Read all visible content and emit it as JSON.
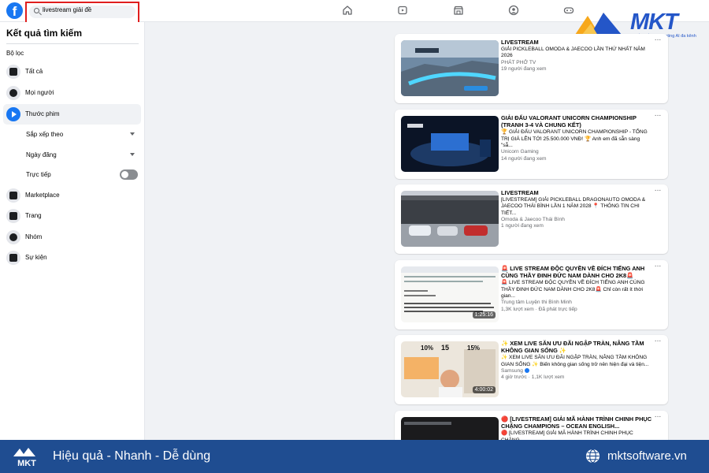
{
  "search": {
    "query": "livestream giải đề"
  },
  "brand": {
    "name": "MKT",
    "tagline": "Phần mềm Marketing AI đa kênh"
  },
  "sidebar": {
    "title": "Kết quả tìm kiếm",
    "filters_heading": "Bộ lọc",
    "items": [
      {
        "label": "Tất cả",
        "icon": "grid-icon"
      },
      {
        "label": "Mọi người",
        "icon": "people-icon"
      },
      {
        "label": "Thước phim",
        "icon": "video-play-icon",
        "active": true
      },
      {
        "label": "Marketplace",
        "icon": "shop-icon"
      },
      {
        "label": "Trang",
        "icon": "flag-icon"
      },
      {
        "label": "Nhóm",
        "icon": "group-icon"
      },
      {
        "label": "Sự kiện",
        "icon": "calendar-icon"
      }
    ],
    "video_filters": {
      "sort_label": "Sắp xếp theo",
      "date_label": "Ngày đăng",
      "live_label": "Trực tiếp",
      "live_on": false
    }
  },
  "results": [
    {
      "title": "LIVESTREAM",
      "desc": "GIẢI PICKLEBALL OMODA & JAECOO LẦN THỨ NHẤT NĂM 2026",
      "channel": "PHÁT PHỞ TV",
      "stats": "19 người đang xem",
      "duration": ""
    },
    {
      "title": "GIẢI ĐẤU VALORANT UNICORN CHAMPIONSHIP (TRANH 3-4 VÀ CHUNG KẾT)",
      "desc": "🏆 GIẢI ĐẤU VALORANT UNICORN CHAMPIONSHIP - TỔNG TRỊ GIÁ LÊN TỚI 25.500.000 VNĐ! 🏆 Anh em đã sẵn sàng \"sẵ...",
      "channel": "Unicorn Gaming",
      "stats": "14 người đang xem",
      "duration": ""
    },
    {
      "title": "LIVESTREAM",
      "desc": "[LIVESTREAM] GIẢI PICKLEBALL DRAGONAUTO OMODA & JAECOO THÁI BÌNH LẦN 1 NĂM 2028 📍 THÔNG TIN CHI TIẾT...",
      "channel": "Omoda & Jaecoo Thái Bình",
      "stats": "1 người đang xem",
      "duration": ""
    },
    {
      "title": "🚨 LIVE STREAM ĐỘC QUYỀN VỀ ĐÍCH TIẾNG ANH CÙNG THẦY ĐINH ĐỨC NAM DÀNH CHO 2K8🚨",
      "desc": "🚨 LIVE STREAM ĐỘC QUYỀN VỀ ĐÍCH TIẾNG ANH CÙNG THẦY ĐINH ĐỨC NAM DÀNH CHO 2K8🚨 Chỉ còn rất ít thời gian...",
      "channel": "Trung tâm Luyện thi Bình Minh",
      "stats": "1,3K lượt xem · Đã phát trực tiếp",
      "duration": "1:25:16"
    },
    {
      "title": "✨ XEM LIVE SĂN ƯU ĐÃI NGẬP TRÀN, NÂNG TẦM KHÔNG GIAN SỐNG ✨",
      "desc": "✨ XEM LIVE SĂN ƯU ĐÃI NGẬP TRÀN, NÂNG TẦM KHÔNG GIAN SỐNG ✨ Biến không gian sống trở nên hiện đại và tiện...",
      "channel": "Samsung",
      "stats": "4 giờ trước · 1,1K lượt xem",
      "duration": "4:00:02",
      "verified": true
    },
    {
      "title": "🔴 [LIVESTREAM] GIẢI MÃ HÀNH TRÌNH CHINH PHỤC CHẶNG CHAMPIONS – OCEAN ENGLISH...",
      "desc": "🔴 [LIVESTREAM] GIẢI MÃ HÀNH TRÌNH CHINH PHỤC CHẶNG",
      "channel": "",
      "stats": "",
      "duration": ""
    }
  ],
  "thumb_texts": {
    "samsung_left": "10%",
    "samsung_mid": "15",
    "samsung_right": "15%"
  },
  "more_label": "···",
  "footer": {
    "slogan": "Hiệu quả - Nhanh - Dễ dùng",
    "website": "mktsoftware.vn",
    "logo_text": "MKT"
  },
  "colors": {
    "facebook_blue": "#1877f2",
    "search_highlight": "#e01e1e",
    "footer_bg": "#1f4d91",
    "brand_blue": "#2456c8"
  }
}
